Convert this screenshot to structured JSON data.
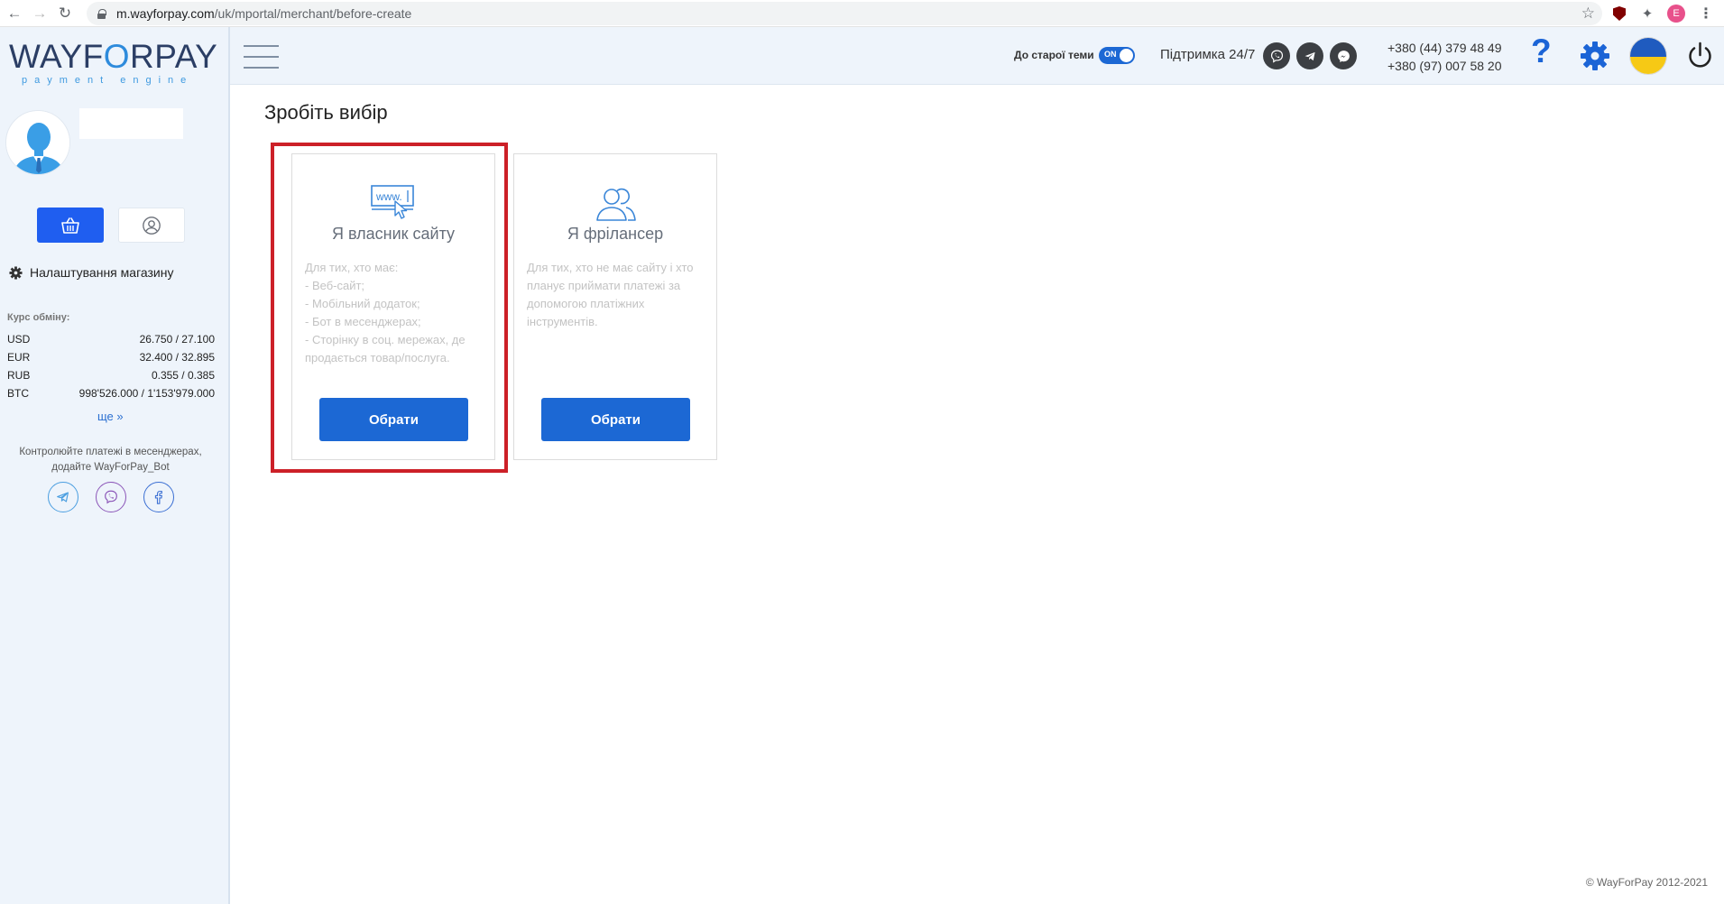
{
  "browser": {
    "url_host": "m.wayforpay.com",
    "url_path": "/uk/mportal/merchant/before-create",
    "profile_initial": "E"
  },
  "header": {
    "old_theme_label": "До старої теми",
    "toggle_label": "ON",
    "support_label": "Підтримка 24/7",
    "phones": [
      "+380 (44) 379 48 49",
      "+380 (97) 007 58 20"
    ],
    "help_label": "?"
  },
  "sidebar": {
    "logo_text_before": "WAYF",
    "logo_text_o": "O",
    "logo_text_after": "RPAY",
    "logo_tagline": "payment engine",
    "shop_settings": "Налаштування магазину",
    "rates_title": "Курс обміну:",
    "rates": [
      {
        "currency": "USD",
        "value": "26.750 / 27.100"
      },
      {
        "currency": "EUR",
        "value": "32.400 / 32.895"
      },
      {
        "currency": "RUB",
        "value": "0.355 / 0.385"
      },
      {
        "currency": "BTC",
        "value": "998'526.000 / 1'153'979.000"
      }
    ],
    "more_label": "ще",
    "bot_text": "Контролюйте платежі в месенджерах, додайте WayForPay_Bot"
  },
  "main": {
    "title": "Зробіть вибір",
    "cards": [
      {
        "title": "Я власник сайту",
        "icon_label": "www.",
        "description": "Для тих, хто має:\n - Веб-сайт;\n - Мобільний додаток;\n - Бот в месенджерах;\n - Сторінку в соц. мережах, де продається товар/послуга.",
        "button": "Обрати"
      },
      {
        "title": "Я фрілансер",
        "description": "Для тих, хто не має сайту і хто планує приймати платежі за допомогою платіжних інструментів.",
        "button": "Обрати"
      }
    ],
    "copyright": "© WayForPay 2012-2021"
  },
  "colors": {
    "primary": "#1c68d4",
    "highlight": "#cc2028",
    "sidebar_bg": "#eef4fb"
  }
}
